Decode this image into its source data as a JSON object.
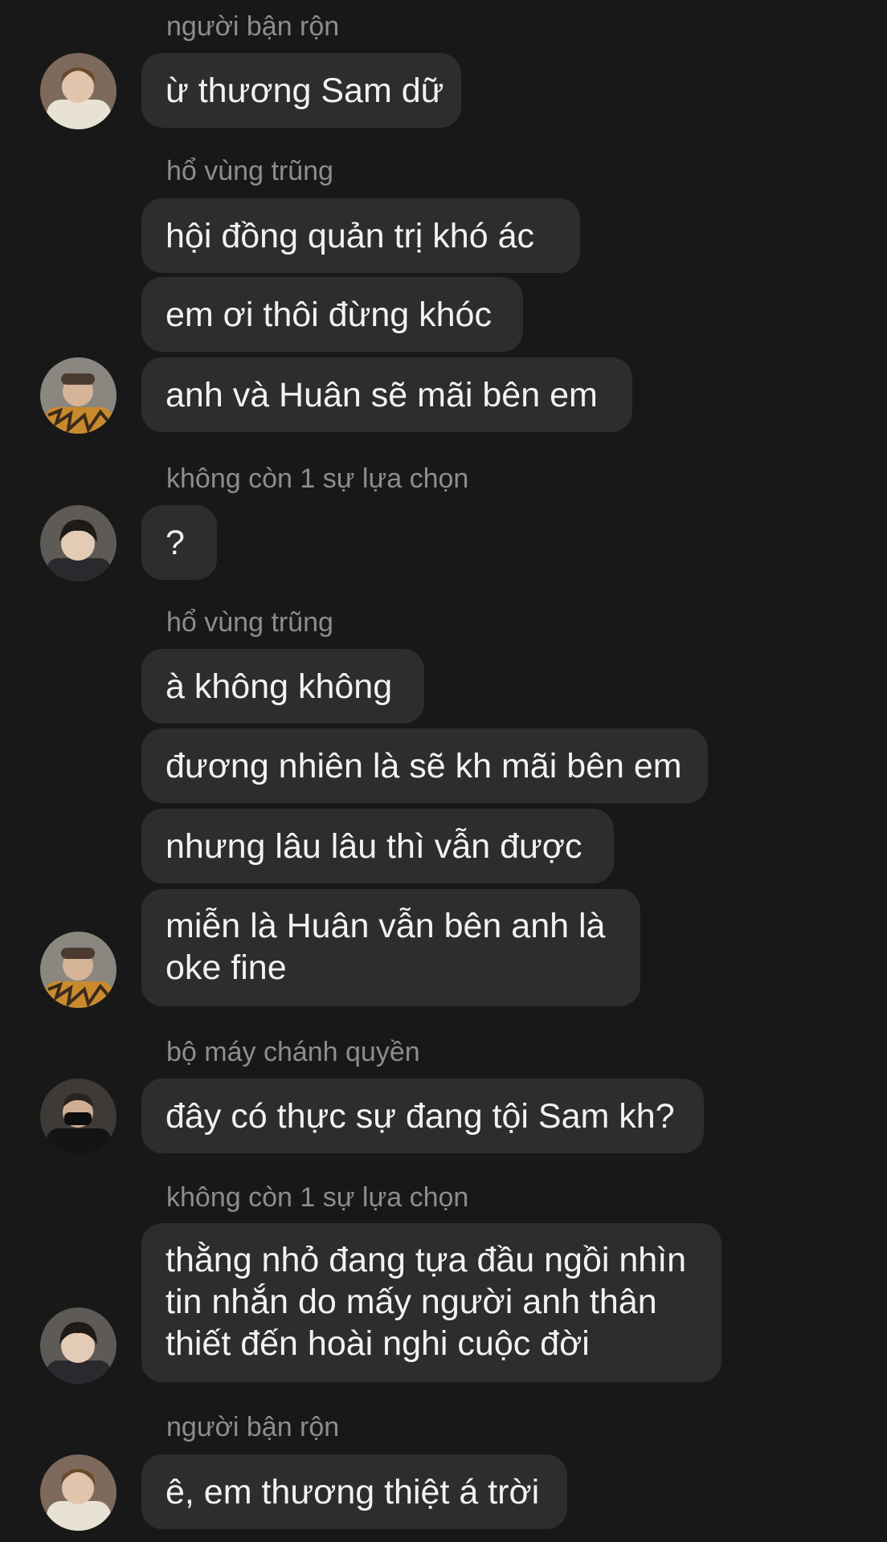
{
  "messages": [
    {
      "sender": "người bận rộn",
      "lines": [
        "ừ thương Sam dữ"
      ]
    },
    {
      "sender": "hổ vùng trũng",
      "lines": [
        "hội đồng quản trị khó ác",
        "em ơi thôi đừng khóc",
        "anh và Huân sẽ mãi bên em"
      ]
    },
    {
      "sender": "không còn 1 sự lựa chọn",
      "lines": [
        "?"
      ]
    },
    {
      "sender": "hổ vùng trũng",
      "lines": [
        "à không không",
        "đương nhiên là sẽ kh mãi bên em",
        "nhưng lâu lâu thì vẫn được",
        "miễn là Huân vẫn bên anh là oke fine"
      ]
    },
    {
      "sender": "bộ máy chánh quyền",
      "lines": [
        "đây có thực sự đang tội Sam kh?"
      ]
    },
    {
      "sender": "không còn 1 sự lựa chọn",
      "lines": [
        "thằng nhỏ đang tựa đầu ngồi nhìn tin nhắn do mấy người anh thân thiết đến hoài nghi cuộc đời"
      ]
    },
    {
      "sender": "người bận rộn",
      "lines": [
        "ê, em thương thiệt á trời"
      ]
    }
  ],
  "colors": {
    "background": "#181818",
    "bubble": "#2d2d2f",
    "text": "#f2f2f2",
    "sender_name": "#8d8d8d"
  }
}
